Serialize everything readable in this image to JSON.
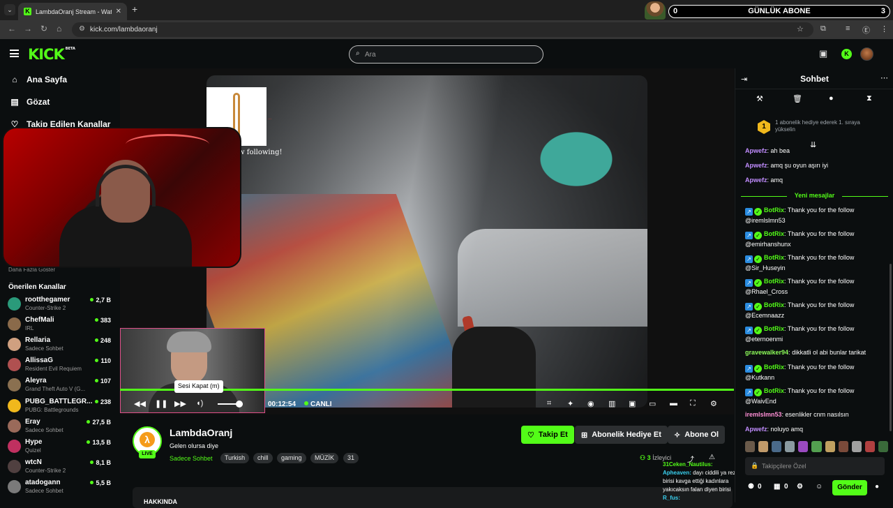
{
  "browser": {
    "tab_title": "LambdaOranj Stream - Watch L",
    "url": "kick.com/lambdaoranj",
    "overlay_left": "0",
    "overlay_center": "GÜNLÜK ABONE",
    "overlay_right": "3"
  },
  "header": {
    "logo": "KICK",
    "logo_sup": "BETA",
    "search_placeholder": "Ara"
  },
  "sidebar": {
    "nav": [
      {
        "label": "Ana Sayfa",
        "icon": "home-icon"
      },
      {
        "label": "Gözat",
        "icon": "browse-icon"
      },
      {
        "label": "Takip Edilen Kanallar",
        "icon": "heart-icon"
      }
    ],
    "show_more": "Daha Fazla Göster",
    "recommended_title": "Önerilen Kanallar",
    "channels": [
      {
        "name": "rootthegamer",
        "category": "Counter-Strike 2",
        "viewers": "2,7 B",
        "color": "#2a9a7a"
      },
      {
        "name": "ChefMali",
        "category": "IRL",
        "viewers": "383",
        "color": "#8a6a4a"
      },
      {
        "name": "Rellaria",
        "category": "Sadece Sohbet",
        "viewers": "248",
        "color": "#d0a080"
      },
      {
        "name": "AllissaG",
        "category": "Resident Evil Requiem",
        "viewers": "110",
        "color": "#b05050"
      },
      {
        "name": "Aleyra",
        "category": "Grand Theft Auto V (G...",
        "viewers": "107",
        "color": "#8a7050"
      },
      {
        "name": "PUBG_BATTLEGR...",
        "category": "PUBG: Battlegrounds",
        "viewers": "238",
        "color": "#f0b81c"
      },
      {
        "name": "Eray",
        "category": "Sadece Sohbet",
        "viewers": "27,5 B",
        "color": "#9a6a5a"
      },
      {
        "name": "Hype",
        "category": "Quizel",
        "viewers": "13,5 B",
        "color": "#c03060"
      },
      {
        "name": "wtcN",
        "category": "Counter-Strike 2",
        "viewers": "8,1 B",
        "color": "#504040"
      },
      {
        "name": "atadogann",
        "category": "Sadece Sohbet",
        "viewers": "5,5 B",
        "color": "#7a7a7a"
      }
    ]
  },
  "video": {
    "follow_alert": "w following!",
    "follow_small": "...",
    "tooltip": "Sesi Kapat (m)",
    "timecode": "00:12:54",
    "live_label": "CANLI",
    "volume_level": 0.85
  },
  "channel": {
    "name": "LambdaOranj",
    "live_badge": "LIVE",
    "title": "Gelen olursa diye",
    "category": "Sadece Sohbet",
    "tags": [
      "Turkish",
      "chill",
      "gaming",
      "MÜZİK",
      "31"
    ],
    "follow_label": "Takip Et",
    "gift_label": "Abonelik Hediye Et",
    "subscribe_label": "Abone Ol",
    "viewers_count": "3",
    "viewers_label": "İzleyici",
    "below_title": "HAKKINDA"
  },
  "floating_chat": {
    "line1_user": "31Ceken_Nautilus:",
    "line2_user": "Apheaven:",
    "line2_text": "dayı ciddili ya rezil birisi kavga ettiği kadınlara yakıcaksın falan diyen birisi",
    "line3_user": "R_fus:"
  },
  "chat": {
    "title": "Sohbet",
    "gift_rank": "1",
    "gift_text": "1 abonelik hediye ederek 1. sıraya yükselin",
    "new_messages": "Yeni mesajlar",
    "messages_before": [
      {
        "user": "Apwefz",
        "text": "ah bea"
      },
      {
        "user": "Apwefz",
        "text": "amq şu oyun aşırı iyi"
      },
      {
        "user": "Apwefz",
        "text": "amq"
      }
    ],
    "messages_after": [
      {
        "user": "BotRix",
        "text": "Thank you for the follow @iremlslmn53",
        "bot": true
      },
      {
        "user": "BotRix",
        "text": "Thank you for the follow @emirhanshunx",
        "bot": true
      },
      {
        "user": "BotRix",
        "text": "Thank you for the follow @Sir_Huseyin",
        "bot": true
      },
      {
        "user": "BotRix",
        "text": "Thank you for the follow @Rhael_Cross",
        "bot": true
      },
      {
        "user": "BotRix",
        "text": "Thank you for the follow @Ecemnaazz",
        "bot": true
      },
      {
        "user": "BotRix",
        "text": "Thank you for the follow @eternoenmi",
        "bot": true
      },
      {
        "user": "gravewalker94",
        "text": "dikkatli ol abi bunlar tarikat",
        "bot": false,
        "color": "u-lime"
      },
      {
        "user": "BotRix",
        "text": "Thank you for the follow @Kutkann",
        "bot": true
      },
      {
        "user": "BotRix",
        "text": "Thank you for the follow @WaivEnd",
        "bot": true
      },
      {
        "user": "iremlslmn53",
        "text": "esenlikler cnm nasılsın",
        "bot": false,
        "color": "u-pink"
      },
      {
        "user": "Apwefz",
        "text": "noluyo amq",
        "bot": false,
        "color": "u-purple"
      }
    ],
    "input_placeholder": "Takipçilere Özel",
    "footer_count_1": "0",
    "footer_count_2": "0",
    "send_label": "Gönder"
  }
}
